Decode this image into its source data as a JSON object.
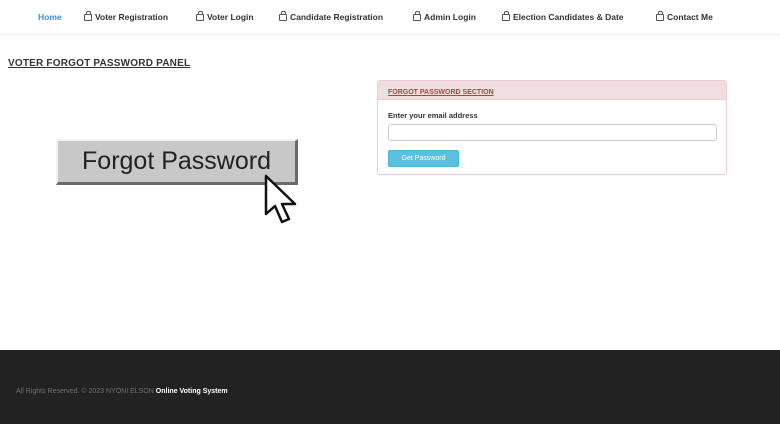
{
  "nav": {
    "items": [
      {
        "label": "Home",
        "icon": "",
        "active": true
      },
      {
        "label": "Voter Registration",
        "icon": "lock-icon",
        "active": false
      },
      {
        "label": "Voter Login",
        "icon": "lock-icon",
        "active": false
      },
      {
        "label": "Candidate Registration",
        "icon": "lock-icon",
        "active": false
      },
      {
        "label": "Admin Login",
        "icon": "lock-icon",
        "active": false
      },
      {
        "label": "Election Candidates & Date",
        "icon": "lock-icon",
        "active": false
      },
      {
        "label": "Contact Me",
        "icon": "lock-icon",
        "active": false
      }
    ]
  },
  "page": {
    "title": "VOTER FORGOT PASSWORD PANEL"
  },
  "illustration": {
    "text": "Forgot Password"
  },
  "panel": {
    "title": "FORGOT PASSWORD SECTION",
    "email_label": "Enter your email address",
    "email_value": "",
    "email_placeholder": "",
    "button_label": "Get Password"
  },
  "footer": {
    "copyright": "All Rights Reserved. © 2023 NYONI ELSON",
    "brand": "Online Voting System"
  },
  "colors": {
    "accent": "#3a8fd8",
    "panel_header_bg": "#f2dede",
    "panel_title": "#a94442",
    "button": "#5bc0de",
    "footer_bg": "#222222"
  }
}
